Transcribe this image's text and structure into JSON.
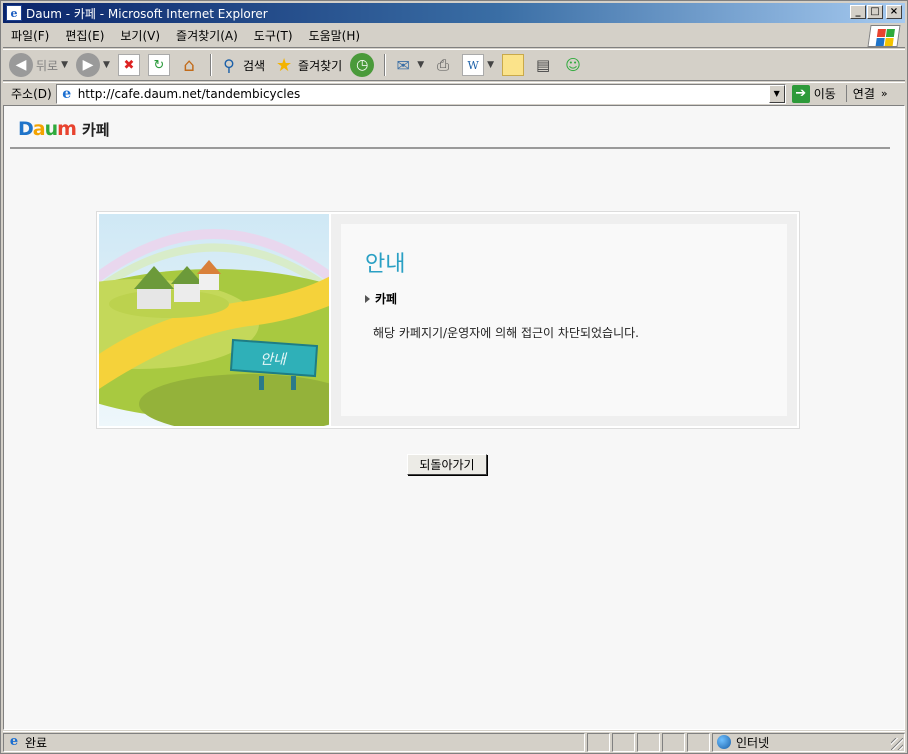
{
  "window": {
    "title": "Daum - 카페 - Microsoft Internet Explorer",
    "controls": {
      "minimize": "_",
      "maximize": "□",
      "close": "×"
    }
  },
  "menu": [
    "파일(F)",
    "편집(E)",
    "보기(V)",
    "즐겨찾기(A)",
    "도구(T)",
    "도움말(H)"
  ],
  "toolbar": {
    "back_label": "뒤로",
    "search_label": "검색",
    "favorites_label": "즐겨찾기",
    "icons": [
      "back-arrow-icon",
      "forward-arrow-icon",
      "stop-icon",
      "refresh-icon",
      "home-icon",
      "search-icon",
      "favorites-star-icon",
      "history-icon",
      "mail-icon",
      "print-icon",
      "edit-word-icon",
      "discuss-icon",
      "research-icon",
      "messenger-icon"
    ]
  },
  "address": {
    "label": "주소(D)",
    "url": "http://cafe.daum.net/tandembicycles",
    "go_label": "이동",
    "links_label": "연결",
    "more": "»"
  },
  "page": {
    "logo": {
      "d": "D",
      "a": "a",
      "u": "u",
      "m": "m"
    },
    "section_title": "카페",
    "notice": {
      "heading": "안내",
      "category": "카페",
      "message": "해당 카페지기/운영자에 의해 접근이 차단되었습니다.",
      "sign_text": "안내"
    },
    "back_button": "되돌아가기"
  },
  "status": {
    "text": "완료",
    "zone": "인터넷"
  },
  "colors": {
    "title_gradient_start": "#0a246a",
    "heading": "#2aa0c4",
    "chrome": "#d4d0c8"
  }
}
